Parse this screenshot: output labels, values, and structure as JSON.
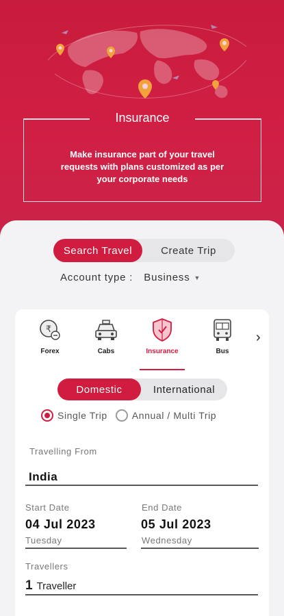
{
  "promo": {
    "title": "Insurance",
    "text": "Make insurance part of your travel requests with plans customized as per your corporate needs"
  },
  "mode_toggle": {
    "active": "Search Travel",
    "inactive": "Create Trip"
  },
  "account": {
    "label": "Account type :",
    "value": "Business"
  },
  "tabs": [
    {
      "label": "Forex",
      "icon": "forex-icon"
    },
    {
      "label": "Cabs",
      "icon": "cab-icon"
    },
    {
      "label": "Insurance",
      "icon": "insurance-shield-icon"
    },
    {
      "label": "Bus",
      "icon": "bus-icon"
    }
  ],
  "region_toggle": {
    "active": "Domestic",
    "inactive": "International"
  },
  "trip_type": {
    "selected": "Single Trip",
    "other": "Annual / Multi Trip"
  },
  "travelling_from": {
    "label": "Travelling From",
    "value": "India"
  },
  "start_date": {
    "label": "Start Date",
    "date": "04 Jul 2023",
    "day": "Tuesday"
  },
  "end_date": {
    "label": "End Date",
    "date": "05 Jul 2023",
    "day": "Wednesday"
  },
  "travellers": {
    "label": "Travellers",
    "count": "1",
    "unit": "Traveller"
  },
  "colors": {
    "brand": "#d01c3f",
    "hero": "#c81c3c"
  }
}
